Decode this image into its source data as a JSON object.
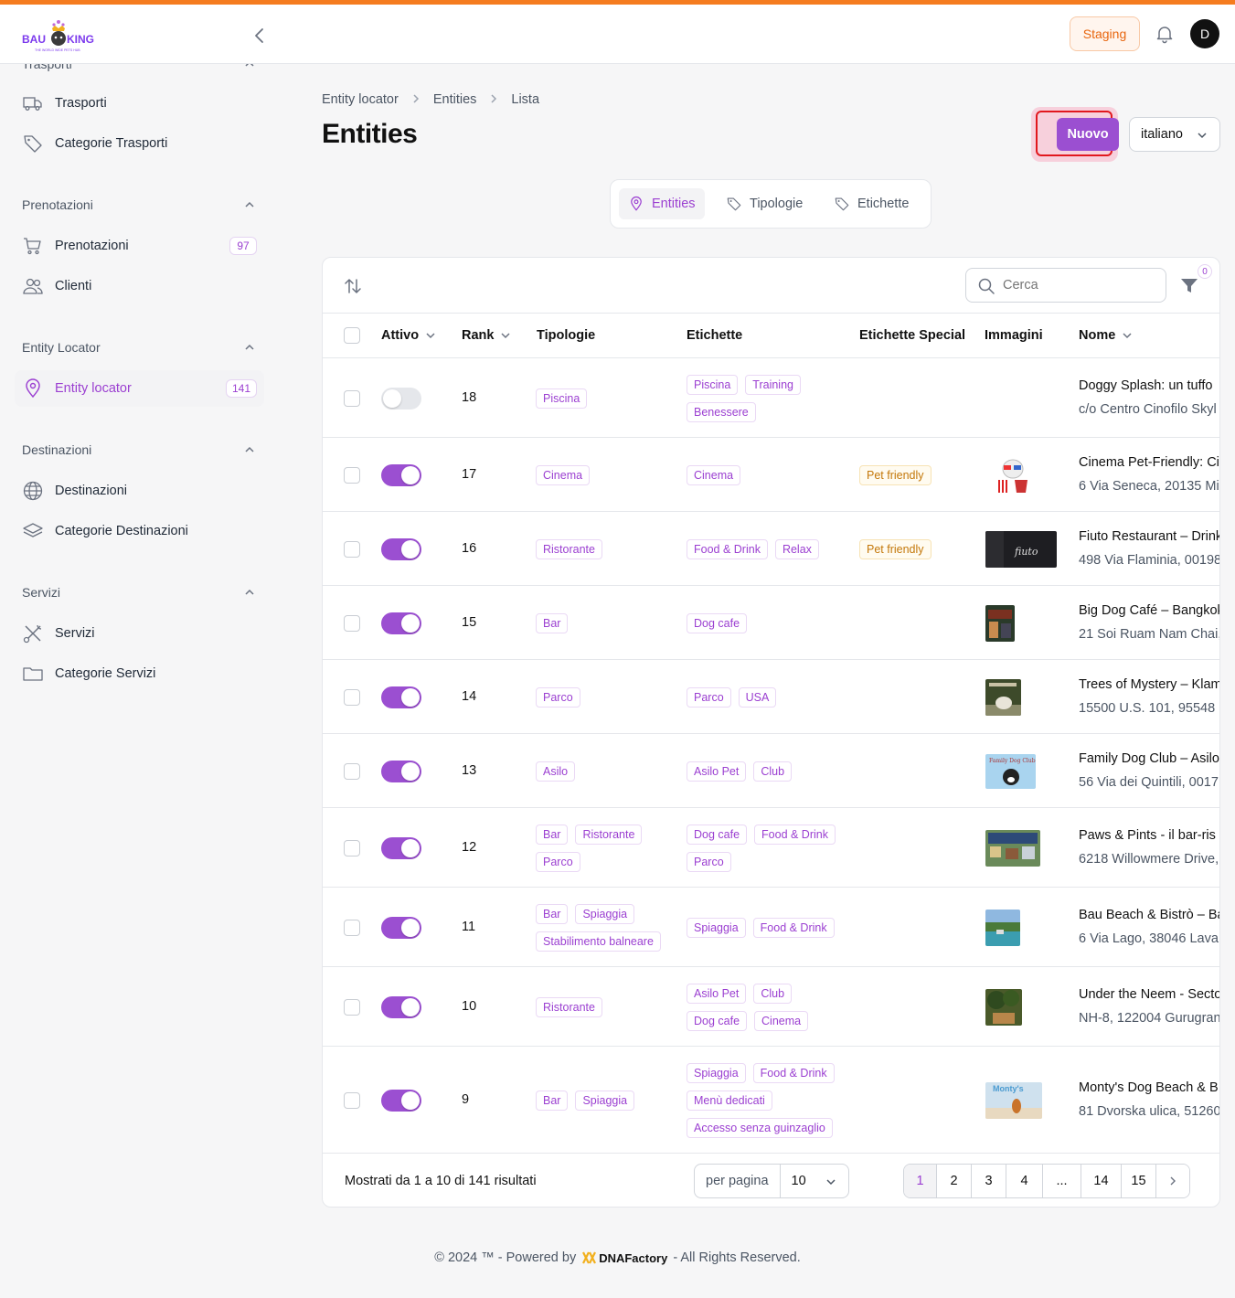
{
  "header": {
    "logo_text": "BAU KING",
    "logo_tagline": "THE WORLD WIDE PETS HUB",
    "staging_label": "Staging",
    "avatar_initial": "D"
  },
  "sidebar": {
    "cut_section": "Trasporti",
    "items_trasporti": [
      {
        "label": "Trasporti",
        "icon": "truck-icon"
      },
      {
        "label": "Categorie Trasporti",
        "icon": "tag-icon"
      }
    ],
    "section_prenotazioni": "Prenotazioni",
    "items_prenotazioni": [
      {
        "label": "Prenotazioni",
        "icon": "cart-icon",
        "badge": "97"
      },
      {
        "label": "Clienti",
        "icon": "users-icon"
      }
    ],
    "section_entity": "Entity Locator",
    "items_entity": [
      {
        "label": "Entity locator",
        "icon": "map-pin-icon",
        "badge": "141",
        "active": true
      }
    ],
    "section_destinazioni": "Destinazioni",
    "items_destinazioni": [
      {
        "label": "Destinazioni",
        "icon": "globe-icon"
      },
      {
        "label": "Categorie Destinazioni",
        "icon": "layers-icon"
      }
    ],
    "section_servizi": "Servizi",
    "items_servizi": [
      {
        "label": "Servizi",
        "icon": "tools-icon"
      },
      {
        "label": "Categorie Servizi",
        "icon": "folder-icon"
      }
    ]
  },
  "breadcrumb": [
    "Entity locator",
    "Entities",
    "Lista"
  ],
  "page": {
    "title": "Entities",
    "new_button": "Nuovo",
    "language": "italiano"
  },
  "tabs": [
    {
      "label": "Entities",
      "active": true
    },
    {
      "label": "Tipologie",
      "active": false
    },
    {
      "label": "Etichette",
      "active": false
    }
  ],
  "toolbar": {
    "search_placeholder": "Cerca",
    "filter_count": "0"
  },
  "table": {
    "columns": [
      "Attivo",
      "Rank",
      "Tipologie",
      "Etichette",
      "Etichette Special",
      "Immagini",
      "Nome"
    ],
    "rows": [
      {
        "active": false,
        "rank": "18",
        "tipologie": [
          "Piscina"
        ],
        "etichette": [
          "Piscina",
          "Training",
          "Benessere"
        ],
        "special": [],
        "image": null,
        "name": "Doggy Splash: un tuffo",
        "address": "c/o Centro Cinofilo Skyl"
      },
      {
        "active": true,
        "rank": "17",
        "tipologie": [
          "Cinema"
        ],
        "etichette": [
          "Cinema"
        ],
        "special": [
          "Pet friendly"
        ],
        "image": "dog-cinema",
        "name": "Cinema Pet-Friendly: Ci",
        "address": "6 Via Seneca, 20135 Mi"
      },
      {
        "active": true,
        "rank": "16",
        "tipologie": [
          "Ristorante"
        ],
        "etichette": [
          "Food & Drink",
          "Relax"
        ],
        "special": [
          "Pet friendly"
        ],
        "image": "fiuto",
        "name": "Fiuto Restaurant – Drink",
        "address": "498 Via Flaminia, 00198"
      },
      {
        "active": true,
        "rank": "15",
        "tipologie": [
          "Bar"
        ],
        "etichette": [
          "Dog cafe"
        ],
        "special": [],
        "image": "bigdog",
        "name": "Big Dog Café – Bangkok",
        "address": "21 Soi Ruam Nam Chai,"
      },
      {
        "active": true,
        "rank": "14",
        "tipologie": [
          "Parco"
        ],
        "etichette": [
          "Parco",
          "USA"
        ],
        "special": [],
        "image": "trees",
        "name": "Trees of Mystery – Klam",
        "address": "15500 U.S. 101, 95548 K"
      },
      {
        "active": true,
        "rank": "13",
        "tipologie": [
          "Asilo"
        ],
        "etichette": [
          "Asilo Pet",
          "Club"
        ],
        "special": [],
        "image": "family",
        "name": "Family Dog Club – Asilo",
        "address": "56 Via dei Quintili, 0017"
      },
      {
        "active": true,
        "rank": "12",
        "tipologie": [
          "Bar",
          "Ristorante",
          "Parco"
        ],
        "etichette": [
          "Dog cafe",
          "Food & Drink",
          "Parco"
        ],
        "special": [],
        "image": "paws",
        "name": "Paws & Pints - il bar-ris",
        "address": "6218 Willowmere Drive,"
      },
      {
        "active": true,
        "rank": "11",
        "tipologie": [
          "Bar",
          "Spiaggia",
          "Stabilimento balneare"
        ],
        "etichette": [
          "Spiaggia",
          "Food & Drink"
        ],
        "special": [],
        "image": "beach",
        "name": "Bau Beach & Bistrò – Ba",
        "address": "6 Via Lago, 38046 Lava"
      },
      {
        "active": true,
        "rank": "10",
        "tipologie": [
          "Ristorante"
        ],
        "etichette": [
          "Asilo Pet",
          "Club",
          "Dog cafe",
          "Cinema"
        ],
        "special": [],
        "image": "neem",
        "name": "Under the Neem - Secto",
        "address": "NH-8, 122004 Gurugran"
      },
      {
        "active": true,
        "rank": "9",
        "tipologie": [
          "Bar",
          "Spiaggia"
        ],
        "etichette": [
          "Spiaggia",
          "Food & Drink",
          "Menù dedicati",
          "Accesso senza guinzaglio"
        ],
        "special": [],
        "image": "montys",
        "name": "Monty's Dog Beach & B",
        "address": "81 Dvorska ulica, 51260"
      }
    ]
  },
  "pagination": {
    "results_text": "Mostrati da 1 a 10 di 141 risultati",
    "per_page_label": "per pagina",
    "per_page_value": "10",
    "pages": [
      "1",
      "2",
      "3",
      "4",
      "...",
      "14",
      "15"
    ],
    "current": "1"
  },
  "footer": {
    "left": "© 2024 ™ - Powered by",
    "brand": "DNAFactory",
    "right": "- All Rights Reserved."
  },
  "colors": {
    "accent": "#9b4fd1",
    "topbar": "#f57c1f",
    "staging": "#e8660f"
  }
}
